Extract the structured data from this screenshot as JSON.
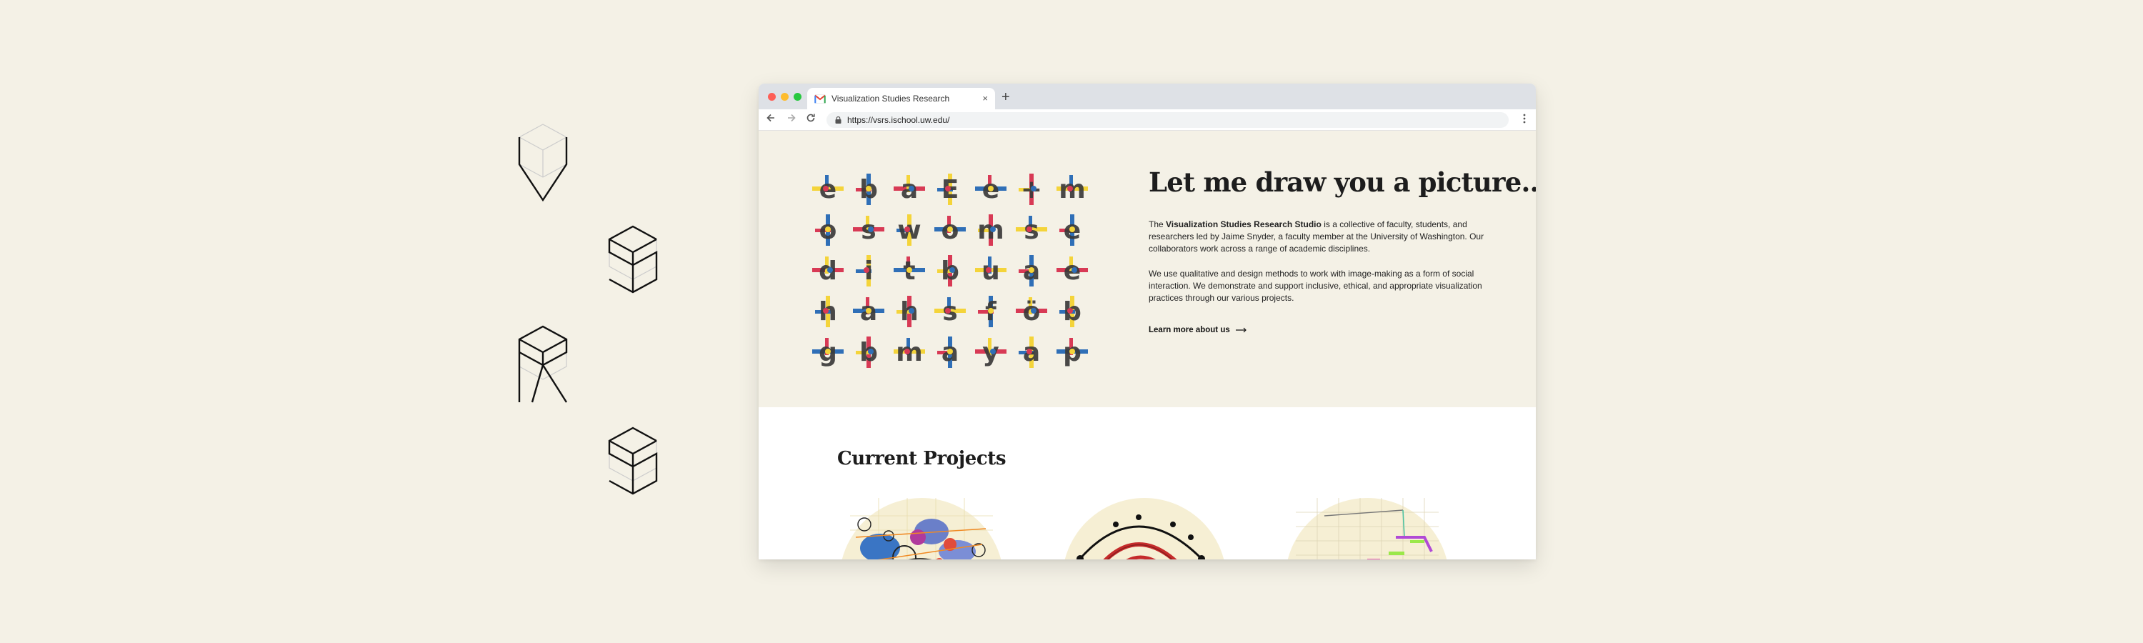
{
  "browser": {
    "tab_title": "Visualization Studies Research",
    "tab_close": "×",
    "new_tab": "+",
    "url": "https://vsrs.ischool.uw.edu/",
    "traffic_lights": {
      "close": "#fe5f57",
      "minimize": "#febc2e",
      "zoom": "#28c840"
    }
  },
  "hero": {
    "title": "Let me draw you a picture...",
    "p1_lead": "The ",
    "p1_strong": "Visualization Studies Research Studio",
    "p1_rest": " is a collective of faculty, students, and researchers led by Jaime Snyder, a faculty member at the University of Washington. Our collaborators work across a range of academic disciplines.",
    "p2": "We use qualitative and design methods to work with image-making as a form of social interaction. We demonstrate and support inclusive, ethical, and appropriate visualization practices through our various projects.",
    "learn_more": "Learn more about us",
    "letter_grid": [
      "e",
      "b",
      "a",
      "E",
      "e",
      "+",
      "m",
      "o",
      "s",
      "w",
      "o",
      "m",
      "s",
      "e",
      "d",
      "i",
      "t",
      "b",
      "u",
      "a",
      "e",
      "h",
      "a",
      "h",
      "s",
      "f",
      "ö",
      "b",
      "g",
      "b",
      "m",
      "a",
      "y",
      "a",
      "p"
    ],
    "letter_colors": {
      "yellow": "#f4d43a",
      "blue": "#2f6fb7",
      "red": "#d83a55",
      "dark": "#3a3a3a"
    }
  },
  "projects": {
    "title": "Current Projects"
  },
  "icons": {
    "back": "back-arrow-icon",
    "forward": "forward-arrow-icon",
    "reload": "reload-icon",
    "lock": "lock-icon",
    "menu": "kebab-menu-icon",
    "gmail": "gmail-icon"
  }
}
